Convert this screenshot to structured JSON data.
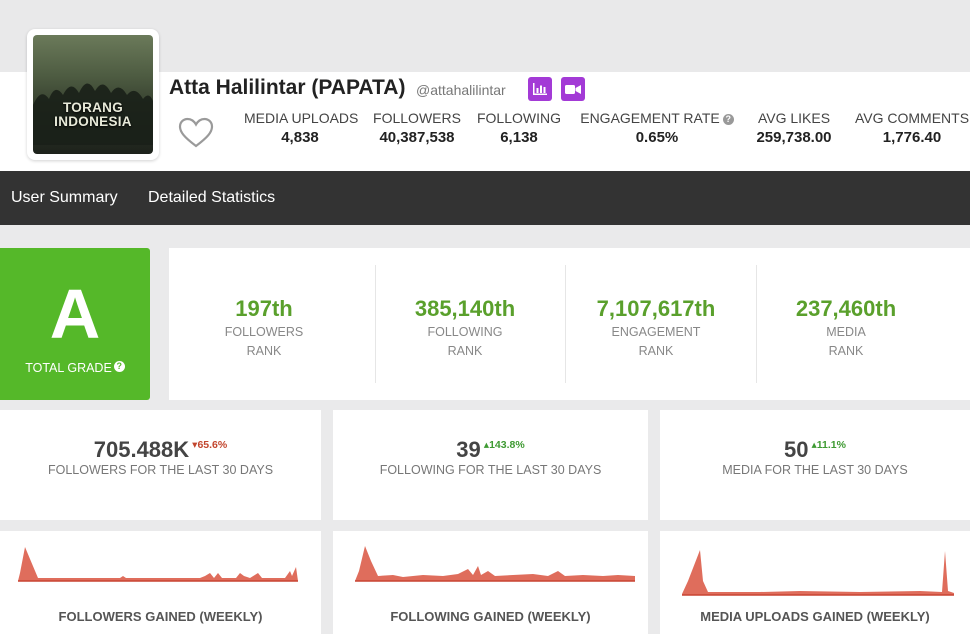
{
  "profile": {
    "name": "Atta Halilintar (PAPATA)",
    "handle": "@attahalilintar",
    "avatar_caption": "TORANG INDONESIA",
    "icons": {
      "stats": "bar-chart-icon",
      "video": "video-camera-icon",
      "like": "heart-icon"
    },
    "accent_color": "#a33ad6"
  },
  "stats": [
    {
      "label": "MEDIA UPLOADS",
      "value": "4,838"
    },
    {
      "label": "FOLLOWERS",
      "value": "40,387,538"
    },
    {
      "label": "FOLLOWING",
      "value": "6,138"
    },
    {
      "label": "ENGAGEMENT RATE",
      "value": "0.65%",
      "help": "?"
    },
    {
      "label": "AVG LIKES",
      "value": "259,738.00"
    },
    {
      "label": "AVG COMMENTS",
      "value": "1,776.40"
    }
  ],
  "nav": {
    "items": [
      "User Summary",
      "Detailed Statistics"
    ]
  },
  "grade": {
    "letter": "A",
    "label": "TOTAL GRADE",
    "help": "?",
    "color": "#55b829"
  },
  "ranks": [
    {
      "value": "197th",
      "line1": "FOLLOWERS",
      "line2": "RANK"
    },
    {
      "value": "385,140th",
      "line1": "FOLLOWING",
      "line2": "RANK"
    },
    {
      "value": "7,107,617th",
      "line1": "ENGAGEMENT",
      "line2": "RANK"
    },
    {
      "value": "237,460th",
      "line1": "MEDIA",
      "line2": "RANK"
    }
  ],
  "last30": [
    {
      "value": "705.488K",
      "change": "65.6%",
      "direction": "down",
      "label": "FOLLOWERS FOR THE LAST 30 DAYS"
    },
    {
      "value": "39",
      "change": "143.8%",
      "direction": "up",
      "label": "FOLLOWING FOR THE LAST 30 DAYS"
    },
    {
      "value": "50",
      "change": "11.1%",
      "direction": "up",
      "label": "MEDIA FOR THE LAST 30 DAYS"
    }
  ],
  "sparklines": [
    {
      "title": "FOLLOWERS GAINED (WEEKLY)"
    },
    {
      "title": "FOLLOWING GAINED (WEEKLY)"
    },
    {
      "title": "MEDIA UPLOADS GAINED (WEEKLY)"
    }
  ],
  "sparkline_color": "#d9533f",
  "colors": {
    "rank_green": "#5aa02c",
    "negative": "#c2452d",
    "positive": "#3e9a32",
    "navbar": "#333333"
  }
}
